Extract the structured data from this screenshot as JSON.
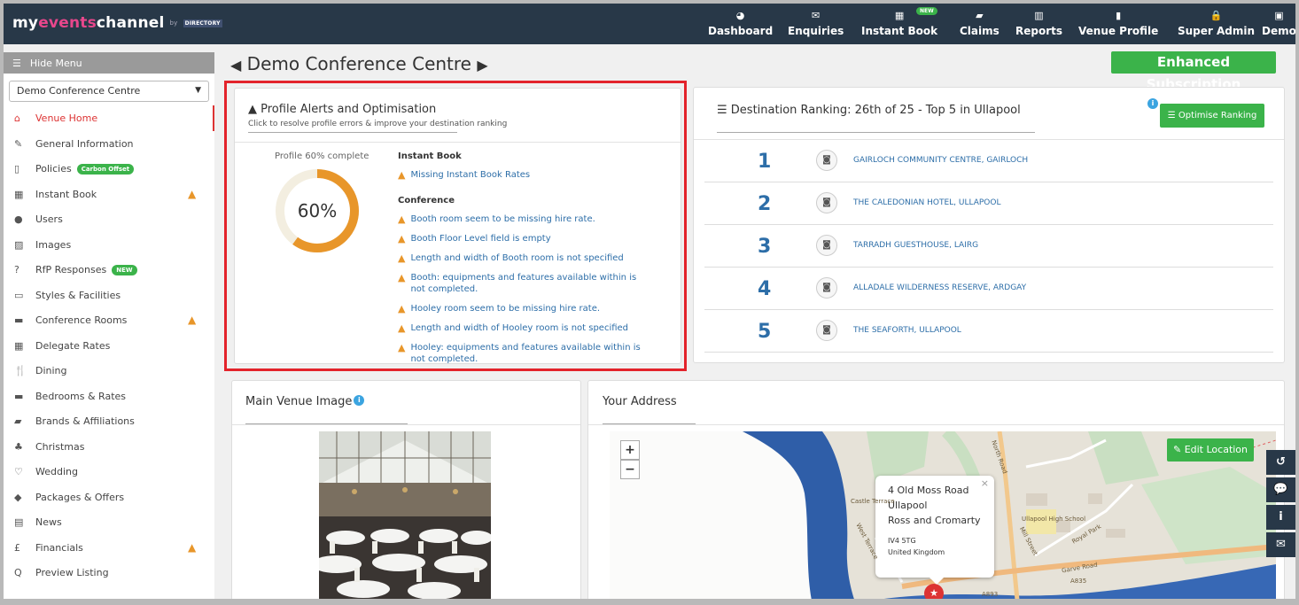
{
  "app": {
    "logo": {
      "part1": "my",
      "accent": "events",
      "part2": "channel",
      "by": "by",
      "dir": "DIRECTORY"
    },
    "nav": [
      {
        "label": "Dashboard",
        "icon": "dashboard-icon",
        "glyph": "◕"
      },
      {
        "label": "Enquiries",
        "icon": "envelope-icon",
        "glyph": "✉"
      },
      {
        "label": "Instant Book",
        "icon": "calendar-icon",
        "glyph": "▦",
        "badge": "NEW"
      },
      {
        "label": "Claims",
        "icon": "book-icon",
        "glyph": "▰"
      },
      {
        "label": "Reports",
        "icon": "chart-icon",
        "glyph": "▥"
      },
      {
        "label": "Venue Profile",
        "icon": "building-icon",
        "glyph": "▮"
      },
      {
        "label": "Super Admin",
        "icon": "lock-icon",
        "glyph": "🔒"
      },
      {
        "label": "Demo",
        "icon": "user-icon",
        "glyph": "▣"
      }
    ]
  },
  "sidebar": {
    "hide_menu": "Hide Menu",
    "venue_select": "Demo Conference Centre",
    "items": [
      {
        "label": "Venue Home",
        "icon": "home-icon",
        "glyph": "⌂",
        "active": true
      },
      {
        "label": "General Information",
        "icon": "edit-icon",
        "glyph": "✎"
      },
      {
        "label": "Policies",
        "icon": "document-icon",
        "glyph": "▯",
        "pill": "Carbon Offset"
      },
      {
        "label": "Instant Book",
        "icon": "calendar-icon",
        "glyph": "▦",
        "warn": true
      },
      {
        "label": "Users",
        "icon": "user-icon",
        "glyph": "●"
      },
      {
        "label": "Images",
        "icon": "image-icon",
        "glyph": "▨"
      },
      {
        "label": "RfP Responses",
        "icon": "question-icon",
        "glyph": "?",
        "pill": "NEW"
      },
      {
        "label": "Styles & Facilities",
        "icon": "monitor-icon",
        "glyph": "▭"
      },
      {
        "label": "Conference Rooms",
        "icon": "briefcase-icon",
        "glyph": "▬",
        "warn": true
      },
      {
        "label": "Delegate Rates",
        "icon": "table-icon",
        "glyph": "▦"
      },
      {
        "label": "Dining",
        "icon": "cutlery-icon",
        "glyph": "🍴"
      },
      {
        "label": "Bedrooms & Rates",
        "icon": "bed-icon",
        "glyph": "▬"
      },
      {
        "label": "Brands & Affiliations",
        "icon": "book-icon",
        "glyph": "▰"
      },
      {
        "label": "Christmas",
        "icon": "tree-icon",
        "glyph": "♣"
      },
      {
        "label": "Wedding",
        "icon": "heart-icon",
        "glyph": "♡"
      },
      {
        "label": "Packages & Offers",
        "icon": "tag-icon",
        "glyph": "◆"
      },
      {
        "label": "News",
        "icon": "newspaper-icon",
        "glyph": "▤"
      },
      {
        "label": "Financials",
        "icon": "pound-icon",
        "glyph": "£",
        "warn": true
      },
      {
        "label": "Preview Listing",
        "icon": "search-icon",
        "glyph": "Q"
      }
    ]
  },
  "page": {
    "title": "Demo Conference Centre",
    "subscription": "Enhanced Subscription"
  },
  "alerts": {
    "title": "Profile Alerts and Optimisation",
    "subtitle": "Click to resolve profile errors & improve your destination ranking",
    "profile_label": "Profile 60% complete",
    "percent_text": "60%",
    "percent_value": 60,
    "sections": [
      {
        "heading": "Instant Book",
        "items": [
          "Missing Instant Book Rates"
        ]
      },
      {
        "heading": "Conference",
        "items": [
          "Booth room seem to be missing hire rate.",
          "Booth Floor Level field is empty",
          "Length and width of Booth room is not specified",
          "Booth: equipments and features available within is not completed.",
          "Hooley room seem to be missing hire rate.",
          "Length and width of Hooley room is not specified",
          "Hooley: equipments and features available within is not completed."
        ]
      }
    ]
  },
  "ranking": {
    "title": "Destination Ranking: 26th of 25 - Top 5 in Ullapool",
    "button": "Optimise Ranking",
    "rows": [
      {
        "rank": "1",
        "name": "GAIRLOCH COMMUNITY CENTRE, GAIRLOCH"
      },
      {
        "rank": "2",
        "name": "THE CALEDONIAN HOTEL, ULLAPOOL"
      },
      {
        "rank": "3",
        "name": "TARRADH GUESTHOUSE, LAIRG"
      },
      {
        "rank": "4",
        "name": "ALLADALE WILDERNESS RESERVE, ARDGAY"
      },
      {
        "rank": "5",
        "name": "THE SEAFORTH, ULLAPOOL"
      }
    ]
  },
  "main_image": {
    "title": "Main Venue Image"
  },
  "address": {
    "title": "Your Address",
    "edit_button": "Edit Location",
    "lines": [
      "4 Old Moss Road",
      "Ullapool",
      "Ross and Cromarty"
    ],
    "postcode": "IV4 5TG",
    "country": "United Kingdom",
    "map_labels": [
      "North Road",
      "Mill Street",
      "Garve Road",
      "A835",
      "A893",
      "Ullapool High School",
      "Royal Park",
      "West Terrace",
      "Castle Terrace"
    ]
  },
  "right_tabs": [
    {
      "icon": "history-icon",
      "glyph": "↺"
    },
    {
      "icon": "chat-icon",
      "glyph": "💬"
    },
    {
      "icon": "info-icon",
      "glyph": "i"
    },
    {
      "icon": "mail-icon",
      "glyph": "✉"
    }
  ],
  "colors": {
    "accent_green": "#3bb34a",
    "nav_bg": "#283848",
    "warning": "#e8962a",
    "link_blue": "#2d6ea8",
    "highlight_red": "#e3232b"
  }
}
